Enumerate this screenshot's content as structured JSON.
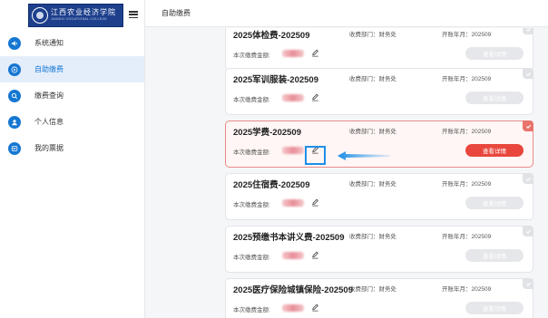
{
  "logo": {
    "cn": "江西农业经济学院",
    "en": "JIANGXI VOCATIONAL COLLEGE"
  },
  "sidebar": {
    "items": [
      {
        "label": "系统通知",
        "icon": "speaker-icon",
        "active": false
      },
      {
        "label": "自助缴费",
        "icon": "play-icon",
        "active": true
      },
      {
        "label": "缴费查询",
        "icon": "search-icon",
        "active": false
      },
      {
        "label": "个人信息",
        "icon": "user-icon",
        "active": false
      },
      {
        "label": "我的票据",
        "icon": "receipt-icon",
        "active": false
      }
    ]
  },
  "header": {
    "breadcrumb": "自助缴费"
  },
  "cards": [
    {
      "title": "2025体检费-202509",
      "dept": "收费部门：财务处",
      "period": "开账年月：202509",
      "amount_label": "本次缴费金额:",
      "button": "查看详情",
      "selected": false
    },
    {
      "title": "2025军训服装-202509",
      "dept": "收费部门：财务处",
      "period": "开账年月：202509",
      "amount_label": "本次缴费金额:",
      "button": "查看详情",
      "selected": false
    },
    {
      "title": "2025学费-202509",
      "dept": "收费部门：财务处",
      "period": "开账年月：202509",
      "amount_label": "本次缴费金额:",
      "button": "查看详情",
      "selected": true
    },
    {
      "title": "2025住宿费-202509",
      "dept": "收费部门：财务处",
      "period": "开账年月：202509",
      "amount_label": "本次缴费金额:",
      "button": "查看详情",
      "selected": false
    },
    {
      "title": "2025预缴书本讲义费-202509",
      "dept": "收费部门：财务处",
      "period": "开账年月：202509",
      "amount_label": "本次缴费金额:",
      "button": "查看详情",
      "selected": false
    },
    {
      "title": "2025医疗保险城镇保险-202509",
      "dept": "收费部门：财务处",
      "period": "开账年月：202509",
      "amount_label": "本次缴费金额:",
      "button": "查看详情",
      "selected": false
    }
  ],
  "colors": {
    "primary": "#1677d2",
    "danger": "#e9473d",
    "highlight": "#1e8fe8"
  }
}
